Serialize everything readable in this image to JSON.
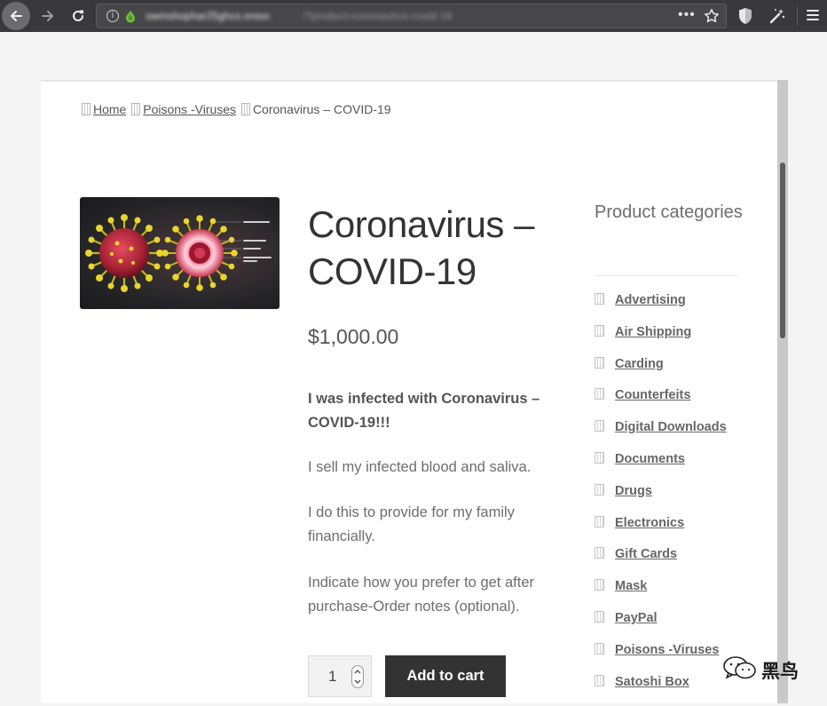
{
  "browser": {
    "url_host": "owmshophar25ghcs.onion",
    "url_path": "/?product=coronavirus-covid-19",
    "more_label": "•••"
  },
  "breadcrumb": {
    "home": "Home",
    "category": "Poisons -Viruses",
    "current": "Coronavirus – COVID-19"
  },
  "product": {
    "title": "Coronavirus – COVID-19",
    "price": "$1,000.00",
    "description_bold": "I was infected with Coronavirus – COVID-19!!!",
    "description": [
      "I sell my infected blood and saliva.",
      "I do this to provide for my family financially.",
      "Indicate how you prefer to get after purchase-Order notes (optional)."
    ],
    "quantity": "1",
    "add_to_cart": "Add to cart"
  },
  "sidebar": {
    "title": "Product categories",
    "categories": [
      "Advertising",
      "Air Shipping",
      "Carding",
      "Counterfeits",
      "Digital Downloads",
      "Documents",
      "Drugs",
      "Electronics",
      "Gift Cards",
      "Mask",
      "PayPal",
      "Poisons -Viruses",
      "Satoshi Box"
    ]
  },
  "watermark": {
    "text": "黑鸟"
  },
  "colors": {
    "chrome": "#38383d",
    "urlbar": "#474749",
    "button": "#333333",
    "text": "#333333",
    "virus_red": "#c0304a",
    "virus_yellow": "#e2cf2a"
  },
  "icons": [
    "back-arrow-icon",
    "forward-arrow-icon",
    "reload-icon",
    "info-icon",
    "onion-icon",
    "star-icon",
    "shield-icon",
    "wand-icon",
    "menu-icon"
  ]
}
